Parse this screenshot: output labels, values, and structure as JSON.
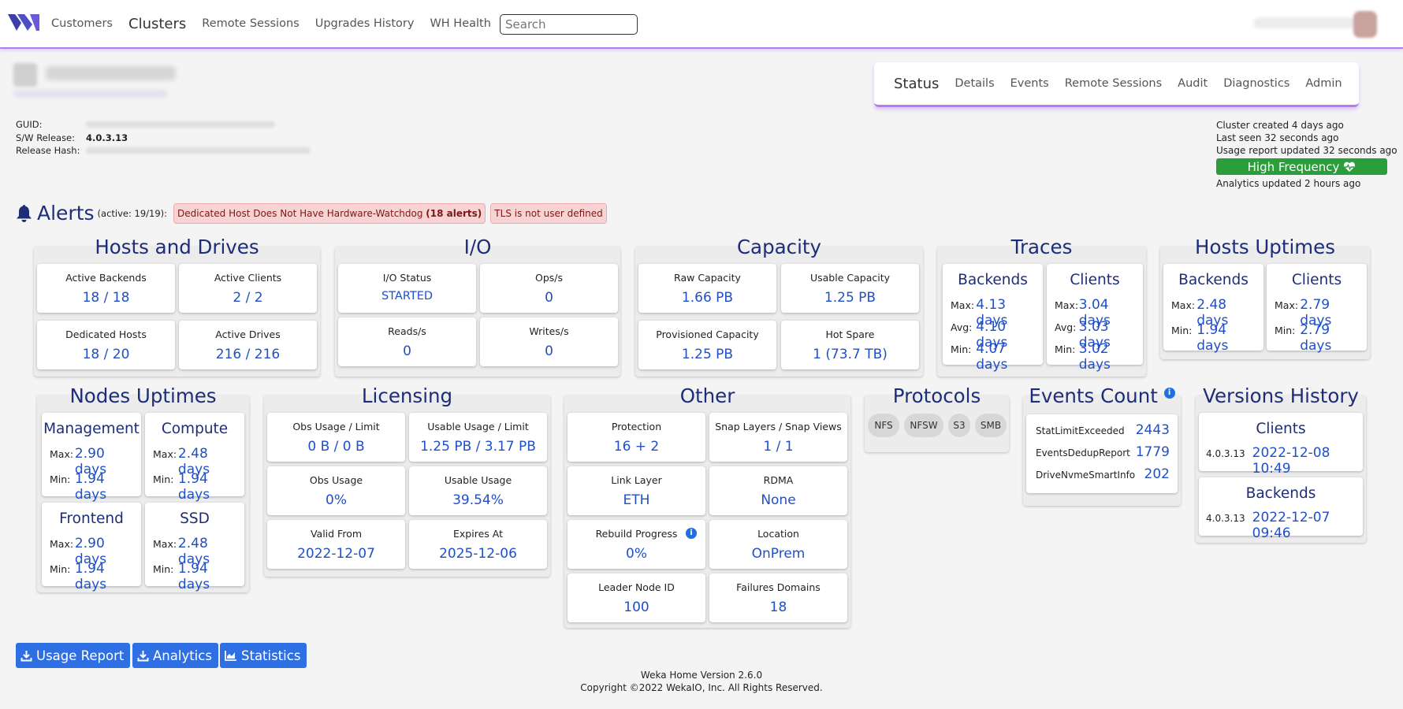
{
  "nav": {
    "items": [
      {
        "label": "Customers",
        "name": "nav-customers",
        "active": false
      },
      {
        "label": "Clusters",
        "name": "nav-clusters",
        "active": true
      },
      {
        "label": "Remote Sessions",
        "name": "nav-remote-sessions",
        "active": false
      },
      {
        "label": "Upgrades History",
        "name": "nav-upgrades-history",
        "active": false
      },
      {
        "label": "WH Health",
        "name": "nav-wh-health",
        "active": false
      }
    ],
    "search_placeholder": "Search"
  },
  "cluster": {
    "guid_label": "GUID:",
    "sw_release_label": "S/W Release:",
    "sw_release": "4.0.3.13",
    "release_hash_label": "Release Hash:"
  },
  "tabs": [
    {
      "label": "Status",
      "name": "tab-status",
      "active": true
    },
    {
      "label": "Details",
      "name": "tab-details",
      "active": false
    },
    {
      "label": "Events",
      "name": "tab-events",
      "active": false
    },
    {
      "label": "Remote Sessions",
      "name": "tab-remote-sessions",
      "active": false
    },
    {
      "label": "Audit",
      "name": "tab-audit",
      "active": false
    },
    {
      "label": "Diagnostics",
      "name": "tab-diagnostics",
      "active": false
    },
    {
      "label": "Admin",
      "name": "tab-admin",
      "active": false
    }
  ],
  "status": {
    "created": "Cluster created 4 days ago",
    "last_seen": "Last seen 32 seconds ago",
    "usage_report": "Usage report updated 32 seconds ago",
    "high_frequency": "High Frequency",
    "analytics": "Analytics updated 2 hours ago"
  },
  "alerts": {
    "title": "Alerts",
    "count": "(active: 19/19):",
    "badges": [
      {
        "prefix": "Dedicated Host Does Not Have Hardware-Watchdog ",
        "bold": "(18 alerts)"
      },
      {
        "prefix": "TLS is not user defined",
        "bold": ""
      }
    ]
  },
  "hosts_drives": {
    "title": "Hosts and Drives",
    "active_backends_label": "Active Backends",
    "active_backends": "18 / 18",
    "active_clients_label": "Active Clients",
    "active_clients": "2 / 2",
    "dedicated_hosts_label": "Dedicated Hosts",
    "dedicated_hosts": "18 / 20",
    "active_drives_label": "Active Drives",
    "active_drives": "216 / 216"
  },
  "io": {
    "title": "I/O",
    "status_label": "I/O Status",
    "status": "STARTED",
    "ops_label": "Ops/s",
    "ops": "0",
    "reads_label": "Reads/s",
    "reads": "0",
    "writes_label": "Writes/s",
    "writes": "0"
  },
  "capacity": {
    "title": "Capacity",
    "raw_label": "Raw Capacity",
    "raw": "1.66 PB",
    "usable_label": "Usable Capacity",
    "usable": "1.25 PB",
    "provisioned_label": "Provisioned Capacity",
    "provisioned": "1.25 PB",
    "hot_spare_label": "Hot Spare",
    "hot_spare": "1 (73.7 TB)"
  },
  "traces": {
    "title": "Traces",
    "backends": {
      "title": "Backends",
      "max_label": "Max:",
      "max": "4.13 days",
      "avg_label": "Avg:",
      "avg": "4.10 days",
      "min_label": "Min:",
      "min": "4.07 days"
    },
    "clients": {
      "title": "Clients",
      "max_label": "Max:",
      "max": "3.04 days",
      "avg_label": "Avg:",
      "avg": "3.03 days",
      "min_label": "Min:",
      "min": "3.02 days"
    }
  },
  "hosts_uptimes": {
    "title": "Hosts Uptimes",
    "backends": {
      "title": "Backends",
      "max_label": "Max:",
      "max": "2.48 days",
      "min_label": "Min:",
      "min": "1.94 days"
    },
    "clients": {
      "title": "Clients",
      "max_label": "Max:",
      "max": "2.79 days",
      "min_label": "Min:",
      "min": "2.79 days"
    }
  },
  "nodes_uptimes": {
    "title": "Nodes Uptimes",
    "management": {
      "title": "Management",
      "max_label": "Max:",
      "max": "2.90 days",
      "min_label": "Min:",
      "min": "1.94 days"
    },
    "compute": {
      "title": "Compute",
      "max_label": "Max:",
      "max": "2.48 days",
      "min_label": "Min:",
      "min": "1.94 days"
    },
    "frontend": {
      "title": "Frontend",
      "max_label": "Max:",
      "max": "2.90 days",
      "min_label": "Min:",
      "min": "1.94 days"
    },
    "ssd": {
      "title": "SSD",
      "max_label": "Max:",
      "max": "2.48 days",
      "min_label": "Min:",
      "min": "1.94 days"
    }
  },
  "licensing": {
    "title": "Licensing",
    "obs_usage_limit_label": "Obs Usage / Limit",
    "obs_usage_limit": "0 B / 0 B",
    "usable_usage_limit_label": "Usable Usage / Limit",
    "usable_usage_limit": "1.25 PB / 3.17 PB",
    "obs_usage_label": "Obs Usage",
    "obs_usage": "0%",
    "usable_usage_label": "Usable Usage",
    "usable_usage": "39.54%",
    "valid_from_label": "Valid From",
    "valid_from": "2022-12-07",
    "expires_at_label": "Expires At",
    "expires_at": "2025-12-06"
  },
  "other": {
    "title": "Other",
    "protection_label": "Protection",
    "protection": "16 + 2",
    "snap_label": "Snap Layers / Snap Views",
    "snap": "1 / 1",
    "link_layer_label": "Link Layer",
    "link_layer": "ETH",
    "rdma_label": "RDMA",
    "rdma": "None",
    "rebuild_label": "Rebuild Progress",
    "rebuild": "0%",
    "location_label": "Location",
    "location": "OnPrem",
    "leader_label": "Leader Node ID",
    "leader": "100",
    "failure_domains_label": "Failures Domains",
    "failure_domains": "18"
  },
  "protocols": {
    "title": "Protocols",
    "items": [
      "NFS",
      "NFSW",
      "S3",
      "SMB"
    ]
  },
  "events_count": {
    "title": "Events Count",
    "rows": [
      {
        "name": "StatLimitExceeded",
        "count": "2443"
      },
      {
        "name": "EventsDedupReport",
        "count": "1779"
      },
      {
        "name": "DriveNvmeSmartInfo",
        "count": "202"
      }
    ]
  },
  "versions_history": {
    "title": "Versions History",
    "clients": {
      "title": "Clients",
      "version": "4.0.3.13",
      "date": "2022-12-08 10:49"
    },
    "backends": {
      "title": "Backends",
      "version": "4.0.3.13",
      "date": "2022-12-07 09:46"
    }
  },
  "buttons": {
    "usage_report": "Usage Report",
    "analytics": "Analytics",
    "statistics": "Statistics"
  },
  "footer": {
    "version": "Weka Home Version 2.6.0",
    "copyright": "Copyright ©2022 WekaIO, Inc. All Rights Reserved."
  },
  "colors": {
    "accent_purple": "#b57bf5",
    "title_navy": "#1e2d78",
    "value_blue": "#1f4fc9",
    "button_blue": "#2f6fe4",
    "success_green": "#2b9e3b",
    "alert_red_bg": "#f8d3d3"
  }
}
